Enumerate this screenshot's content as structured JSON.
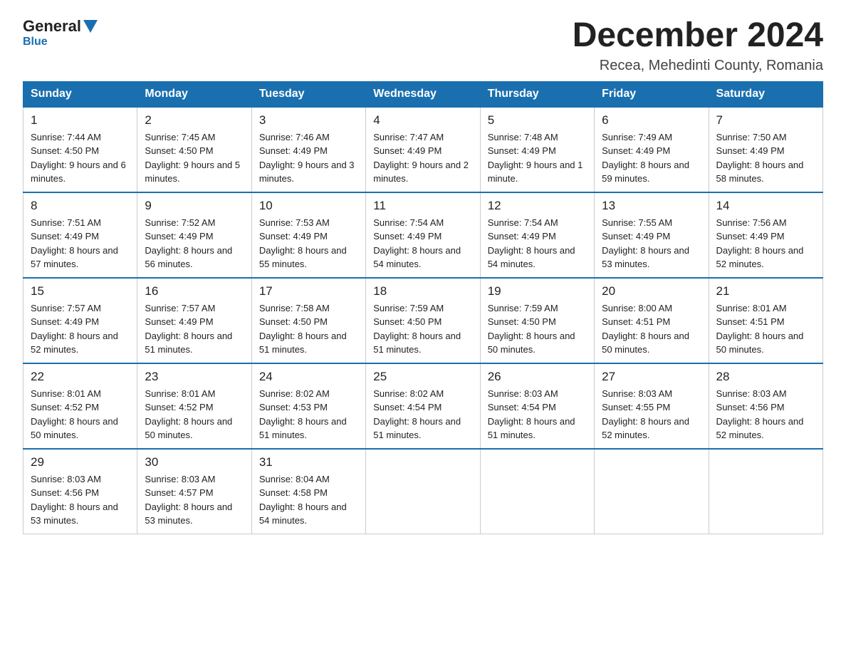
{
  "header": {
    "logo_general": "General",
    "logo_blue": "Blue",
    "month_title": "December 2024",
    "location": "Recea, Mehedinti County, Romania"
  },
  "weekdays": [
    "Sunday",
    "Monday",
    "Tuesday",
    "Wednesday",
    "Thursday",
    "Friday",
    "Saturday"
  ],
  "weeks": [
    [
      {
        "day": "1",
        "sunrise": "7:44 AM",
        "sunset": "4:50 PM",
        "daylight": "9 hours and 6 minutes."
      },
      {
        "day": "2",
        "sunrise": "7:45 AM",
        "sunset": "4:50 PM",
        "daylight": "9 hours and 5 minutes."
      },
      {
        "day": "3",
        "sunrise": "7:46 AM",
        "sunset": "4:49 PM",
        "daylight": "9 hours and 3 minutes."
      },
      {
        "day": "4",
        "sunrise": "7:47 AM",
        "sunset": "4:49 PM",
        "daylight": "9 hours and 2 minutes."
      },
      {
        "day": "5",
        "sunrise": "7:48 AM",
        "sunset": "4:49 PM",
        "daylight": "9 hours and 1 minute."
      },
      {
        "day": "6",
        "sunrise": "7:49 AM",
        "sunset": "4:49 PM",
        "daylight": "8 hours and 59 minutes."
      },
      {
        "day": "7",
        "sunrise": "7:50 AM",
        "sunset": "4:49 PM",
        "daylight": "8 hours and 58 minutes."
      }
    ],
    [
      {
        "day": "8",
        "sunrise": "7:51 AM",
        "sunset": "4:49 PM",
        "daylight": "8 hours and 57 minutes."
      },
      {
        "day": "9",
        "sunrise": "7:52 AM",
        "sunset": "4:49 PM",
        "daylight": "8 hours and 56 minutes."
      },
      {
        "day": "10",
        "sunrise": "7:53 AM",
        "sunset": "4:49 PM",
        "daylight": "8 hours and 55 minutes."
      },
      {
        "day": "11",
        "sunrise": "7:54 AM",
        "sunset": "4:49 PM",
        "daylight": "8 hours and 54 minutes."
      },
      {
        "day": "12",
        "sunrise": "7:54 AM",
        "sunset": "4:49 PM",
        "daylight": "8 hours and 54 minutes."
      },
      {
        "day": "13",
        "sunrise": "7:55 AM",
        "sunset": "4:49 PM",
        "daylight": "8 hours and 53 minutes."
      },
      {
        "day": "14",
        "sunrise": "7:56 AM",
        "sunset": "4:49 PM",
        "daylight": "8 hours and 52 minutes."
      }
    ],
    [
      {
        "day": "15",
        "sunrise": "7:57 AM",
        "sunset": "4:49 PM",
        "daylight": "8 hours and 52 minutes."
      },
      {
        "day": "16",
        "sunrise": "7:57 AM",
        "sunset": "4:49 PM",
        "daylight": "8 hours and 51 minutes."
      },
      {
        "day": "17",
        "sunrise": "7:58 AM",
        "sunset": "4:50 PM",
        "daylight": "8 hours and 51 minutes."
      },
      {
        "day": "18",
        "sunrise": "7:59 AM",
        "sunset": "4:50 PM",
        "daylight": "8 hours and 51 minutes."
      },
      {
        "day": "19",
        "sunrise": "7:59 AM",
        "sunset": "4:50 PM",
        "daylight": "8 hours and 50 minutes."
      },
      {
        "day": "20",
        "sunrise": "8:00 AM",
        "sunset": "4:51 PM",
        "daylight": "8 hours and 50 minutes."
      },
      {
        "day": "21",
        "sunrise": "8:01 AM",
        "sunset": "4:51 PM",
        "daylight": "8 hours and 50 minutes."
      }
    ],
    [
      {
        "day": "22",
        "sunrise": "8:01 AM",
        "sunset": "4:52 PM",
        "daylight": "8 hours and 50 minutes."
      },
      {
        "day": "23",
        "sunrise": "8:01 AM",
        "sunset": "4:52 PM",
        "daylight": "8 hours and 50 minutes."
      },
      {
        "day": "24",
        "sunrise": "8:02 AM",
        "sunset": "4:53 PM",
        "daylight": "8 hours and 51 minutes."
      },
      {
        "day": "25",
        "sunrise": "8:02 AM",
        "sunset": "4:54 PM",
        "daylight": "8 hours and 51 minutes."
      },
      {
        "day": "26",
        "sunrise": "8:03 AM",
        "sunset": "4:54 PM",
        "daylight": "8 hours and 51 minutes."
      },
      {
        "day": "27",
        "sunrise": "8:03 AM",
        "sunset": "4:55 PM",
        "daylight": "8 hours and 52 minutes."
      },
      {
        "day": "28",
        "sunrise": "8:03 AM",
        "sunset": "4:56 PM",
        "daylight": "8 hours and 52 minutes."
      }
    ],
    [
      {
        "day": "29",
        "sunrise": "8:03 AM",
        "sunset": "4:56 PM",
        "daylight": "8 hours and 53 minutes."
      },
      {
        "day": "30",
        "sunrise": "8:03 AM",
        "sunset": "4:57 PM",
        "daylight": "8 hours and 53 minutes."
      },
      {
        "day": "31",
        "sunrise": "8:04 AM",
        "sunset": "4:58 PM",
        "daylight": "8 hours and 54 minutes."
      },
      null,
      null,
      null,
      null
    ]
  ],
  "labels": {
    "sunrise": "Sunrise:",
    "sunset": "Sunset:",
    "daylight": "Daylight:"
  }
}
